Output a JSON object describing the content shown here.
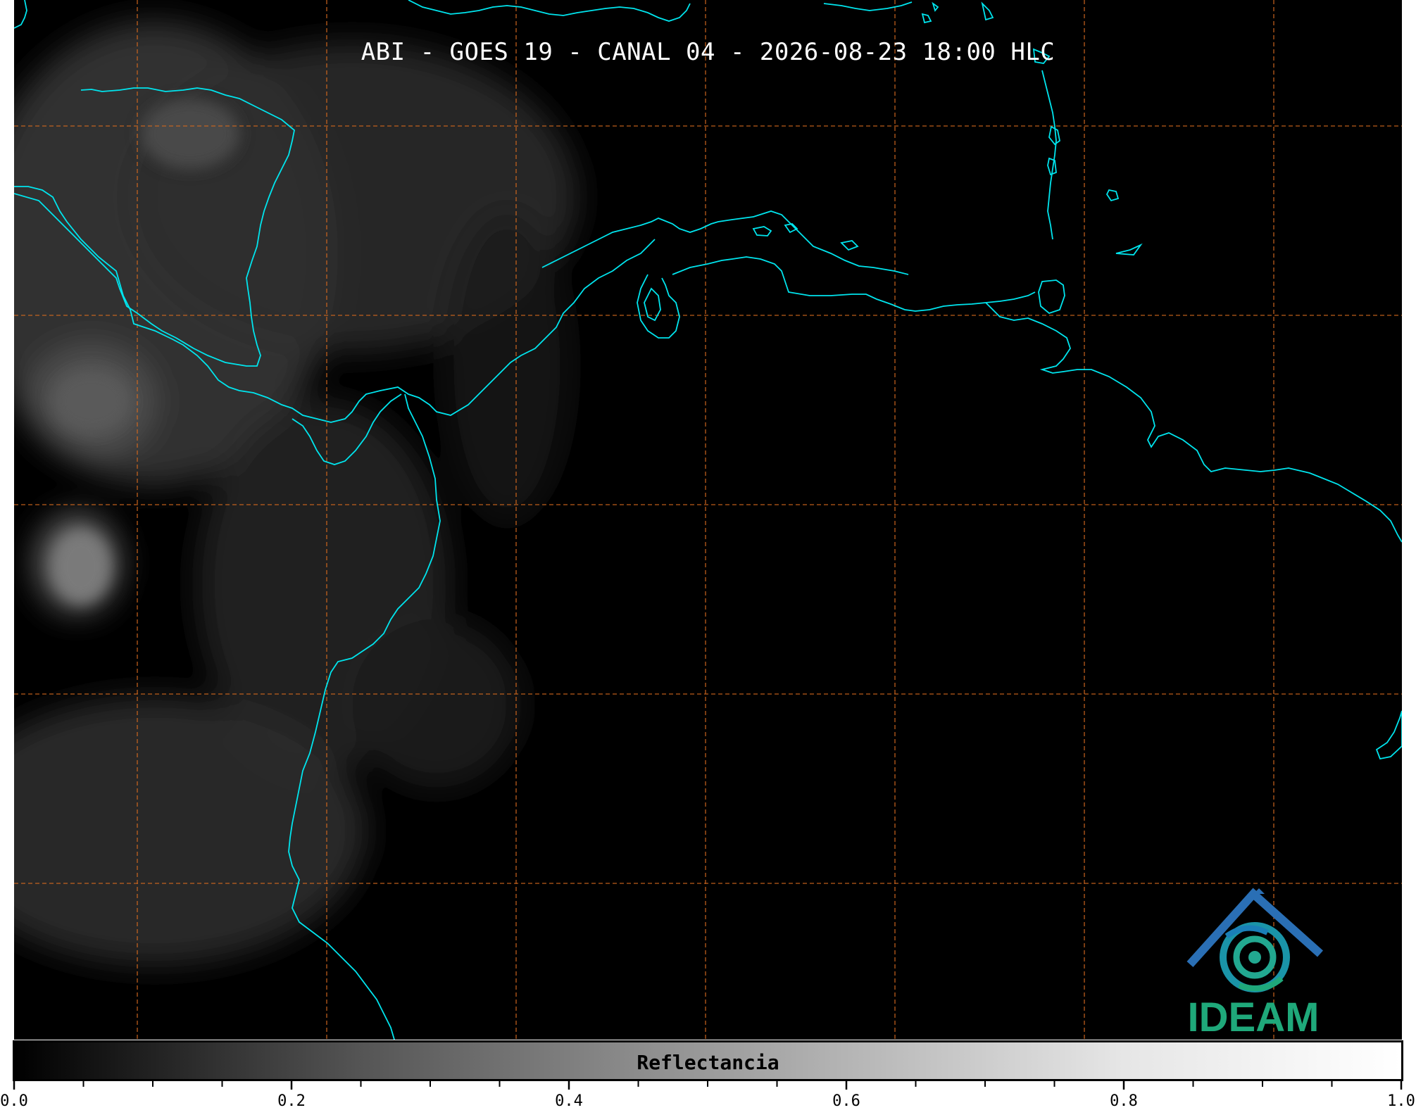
{
  "title": "ABI - GOES 19 - CANAL 04 - 2026-08-23 18:00 HLC",
  "colorbar": {
    "label": "Reflectancia",
    "ticks": [
      "0.0",
      "0.2",
      "0.4",
      "0.6",
      "0.8",
      "1.0"
    ]
  },
  "logo": {
    "text": "IDEAM"
  },
  "colors": {
    "background": "#000000",
    "coastline": "#00e5ee",
    "gridline": "#d2691e",
    "logo_green": "#1fa87a",
    "logo_blue": "#2a6fb5"
  }
}
